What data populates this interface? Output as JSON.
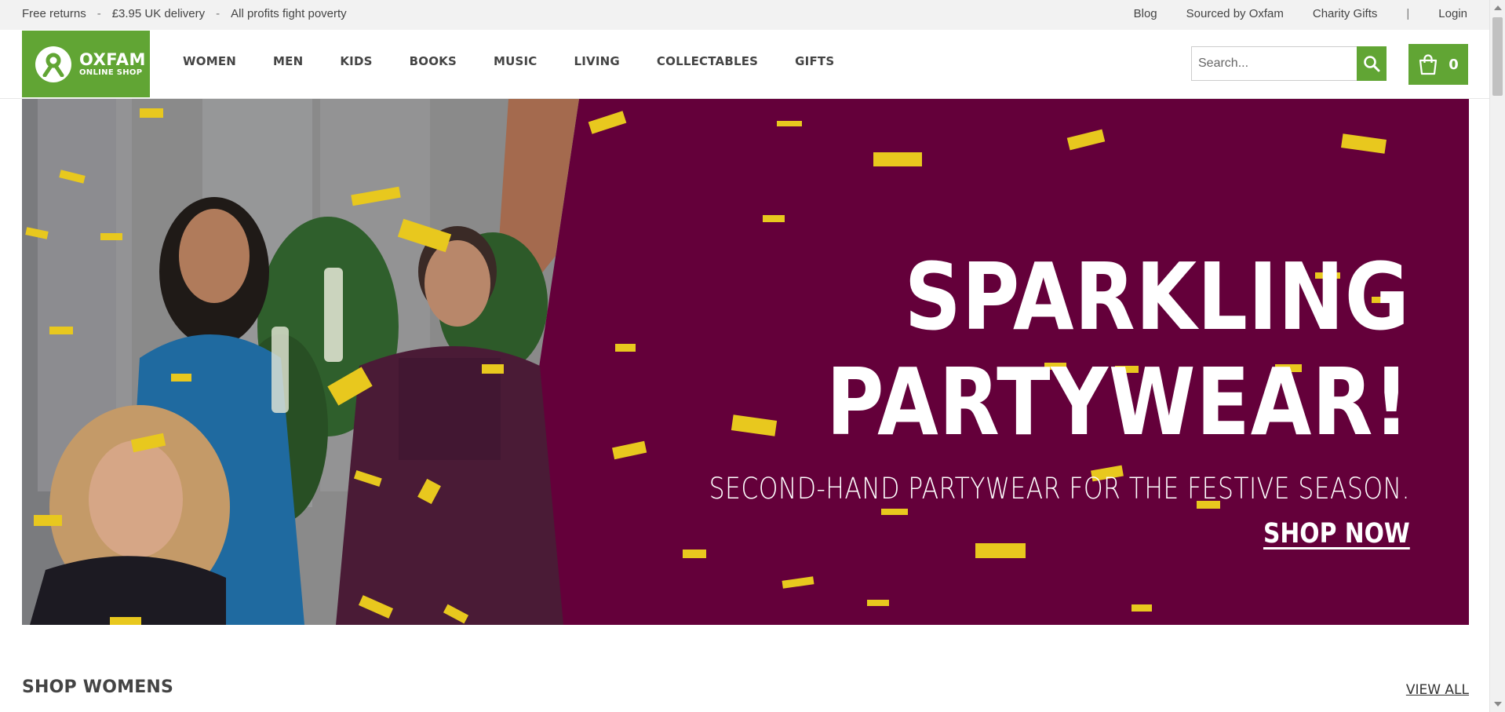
{
  "topbar": {
    "promos": [
      "Free returns",
      "£3.95 UK delivery",
      "All profits fight poverty"
    ],
    "separator": "-",
    "links": {
      "blog": "Blog",
      "sourced": "Sourced by Oxfam",
      "charity": "Charity Gifts",
      "pipe": "|",
      "login": "Login"
    }
  },
  "logo": {
    "name": "OXFAM",
    "tagline": "ONLINE SHOP",
    "icon": "oxfam-logo-icon"
  },
  "nav": {
    "items": [
      "WOMEN",
      "MEN",
      "KIDS",
      "BOOKS",
      "MUSIC",
      "LIVING",
      "COLLECTABLES",
      "GIFTS"
    ]
  },
  "search": {
    "placeholder": "Search...",
    "icon": "search-icon"
  },
  "cart": {
    "count": "0",
    "icon": "shopping-bag-icon"
  },
  "hero": {
    "title_line1": "SPARKLING",
    "title_line2": "PARTYWEAR!",
    "subtitle": "SECOND-HAND PARTYWEAR FOR THE FESTIVE SEASON.",
    "cta": "SHOP NOW"
  },
  "section": {
    "title": "SHOP WOMENS",
    "view_all": "VIEW ALL"
  },
  "colors": {
    "brand_green": "#61a534",
    "hero_bg": "#64003a",
    "confetti_gold": "#e8c81e",
    "topbar_bg": "#f2f2f2"
  }
}
